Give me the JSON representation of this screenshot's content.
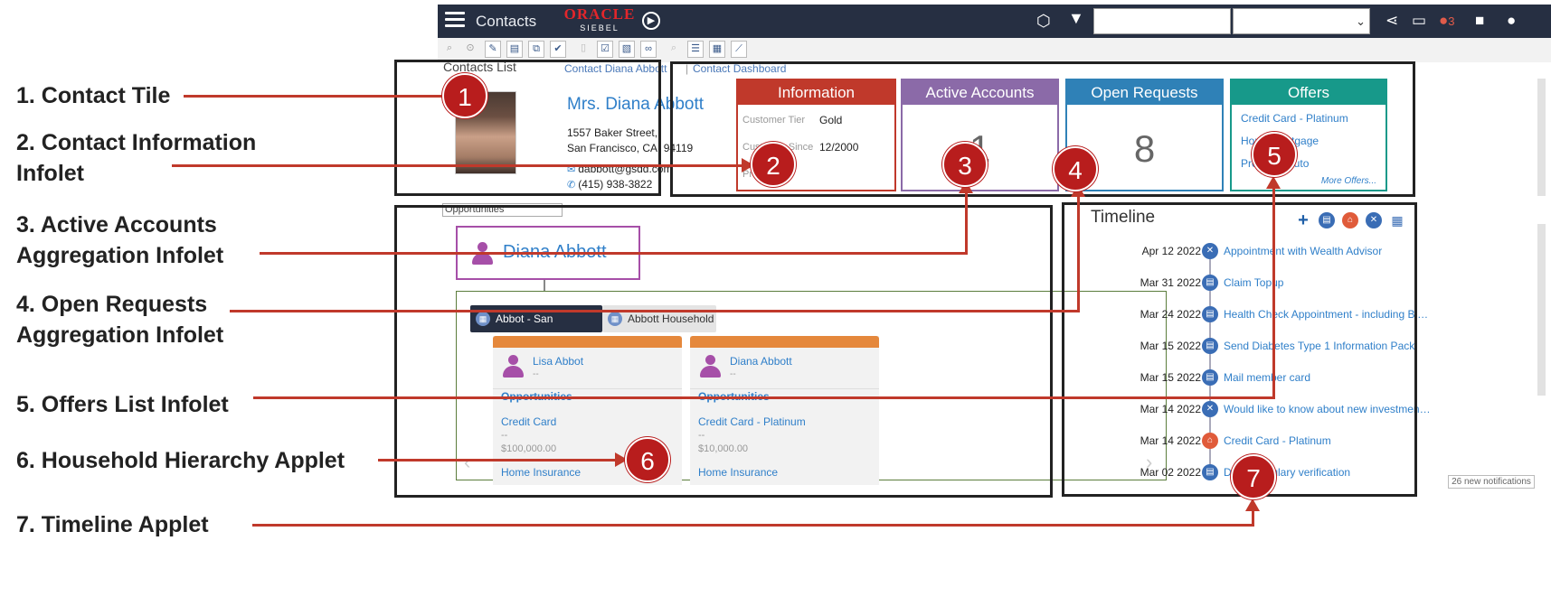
{
  "labels": [
    {
      "l1": "1. Contact Tile",
      "l2": ""
    },
    {
      "l1": "2. Contact Information",
      "l2": "Infolet"
    },
    {
      "l1": "3. Active Accounts",
      "l2": "Aggregation Infolet"
    },
    {
      "l1": "4. Open Requests",
      "l2": "Aggregation Infolet"
    },
    {
      "l1": "5. Offers List Infolet",
      "l2": ""
    },
    {
      "l1": "6. Household Hierarchy Applet",
      "l2": ""
    },
    {
      "l1": "7. Timeline Applet",
      "l2": ""
    }
  ],
  "badges": [
    "1",
    "2",
    "3",
    "4",
    "5",
    "6",
    "7"
  ],
  "topbar": {
    "title": "Contacts",
    "logo_top": "ORACLE",
    "logo_bottom": "SIEBEL",
    "notif_count": "3",
    "select_caret": "⌄"
  },
  "breadcrumb": {
    "view": "Contacts List",
    "link1": "Contact Diana Abbott",
    "link2": "Contact Dashboard"
  },
  "contact": {
    "name": "Mrs. Diana Abbott",
    "street": "1557 Baker Street,",
    "city": "San Francisco, CA, 94119",
    "email": "dabbott@gsdd.com",
    "phone": "(415) 938-3822"
  },
  "infolet_info": {
    "title": "Information",
    "rows": [
      {
        "label": "Customer Tier",
        "value": "Gold"
      },
      {
        "label": "Customer Since",
        "value": "12/2000"
      },
      {
        "label": "Profitability",
        "value": ""
      }
    ]
  },
  "infolet_accounts": {
    "title": "Active Accounts",
    "count": "1"
  },
  "infolet_requests": {
    "title": "Open Requests",
    "count": "8"
  },
  "infolet_offers": {
    "title": "Offers",
    "items": [
      "Credit Card - Platinum",
      "Home Mortgage",
      "Premium Auto"
    ],
    "more": "More Offers..."
  },
  "household": {
    "selector": "Opportunities",
    "root_name": "Diana Abbott",
    "tabs": [
      "Abbot - San Francisco",
      "Abbott Household"
    ],
    "members": [
      {
        "name": "Lisa Abbot",
        "sub": "--",
        "section": "Opportunities",
        "item1": "Credit Card",
        "item1_sub": "--",
        "amount": "$100,000.00",
        "item2": "Home Insurance"
      },
      {
        "name": "Diana Abbott",
        "sub": "--",
        "section": "Opportunities",
        "item1": "Credit Card - Platinum",
        "item1_sub": "--",
        "amount": "$10,000.00",
        "item2": "Home Insurance"
      }
    ]
  },
  "timeline": {
    "title": "Timeline",
    "entries": [
      {
        "date": "Apr 12 2022",
        "text": "Appointment with Wealth Advisor",
        "type": "tools"
      },
      {
        "date": "Mar 31 2022",
        "text": "Claim Topup",
        "type": "doc"
      },
      {
        "date": "Mar 24 2022",
        "text": "Health Check Appointment - including Blo...",
        "type": "doc"
      },
      {
        "date": "Mar 15 2022",
        "text": "Send Diabetes Type 1 Information Pack",
        "type": "doc"
      },
      {
        "date": "Mar 15 2022",
        "text": "Mail member card",
        "type": "doc"
      },
      {
        "date": "Mar 14 2022",
        "text": "Would like to know about new investment ...",
        "type": "tools"
      },
      {
        "date": "Mar 14 2022",
        "text": "Credit Card - Platinum",
        "type": "offer"
      },
      {
        "date": "Mar 02 2022",
        "text": "Drug formulary verification",
        "type": "doc"
      }
    ],
    "notification": "26 new notifications"
  },
  "colors": {
    "information": "#c0392b",
    "active_accounts": "#8b6aa8",
    "open_requests": "#2f81b7",
    "offers": "#17998a",
    "annotation": "#c0392b"
  }
}
